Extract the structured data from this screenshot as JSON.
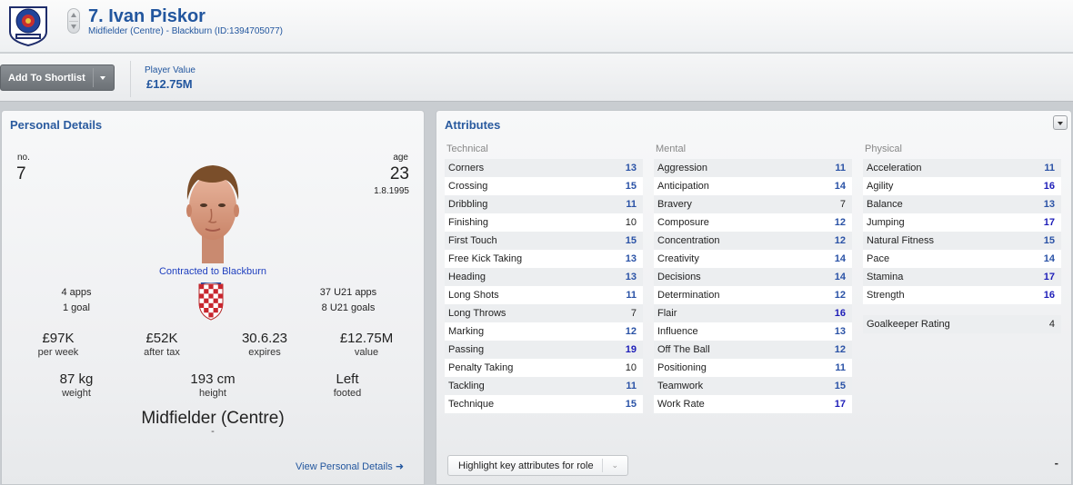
{
  "header": {
    "player_name": "7. Ivan Piskor",
    "subtitle": "Midfielder (Centre) - Blackburn (ID:1394705077)"
  },
  "toolbar": {
    "shortlist_label": "Add To Shortlist",
    "value_label": "Player Value",
    "value_amount": "£12.75M"
  },
  "personal": {
    "title": "Personal Details",
    "no_label": "no.",
    "no_value": "7",
    "age_label": "age",
    "age_value": "23",
    "dob": "1.8.1995",
    "contract": "Contracted to Blackburn",
    "apps": "4 apps",
    "goals": "1 goal",
    "u21_apps": "37 U21 apps",
    "u21_goals": "8 U21 goals",
    "stats": [
      {
        "value": "£97K",
        "label": "per week"
      },
      {
        "value": "£52K",
        "label": "after tax"
      },
      {
        "value": "30.6.23",
        "label": "expires"
      },
      {
        "value": "£12.75M",
        "label": "value"
      }
    ],
    "body": [
      {
        "value": "87 kg",
        "label": "weight"
      },
      {
        "value": "193 cm",
        "label": "height"
      },
      {
        "value": "Left",
        "label": "footed"
      }
    ],
    "position": "Midfielder (Centre)",
    "position_sub": "-",
    "view_link": "View Personal Details ➜"
  },
  "attributes": {
    "title": "Attributes",
    "technical_head": "Technical",
    "mental_head": "Mental",
    "physical_head": "Physical",
    "technical": [
      {
        "name": "Corners",
        "value": "13"
      },
      {
        "name": "Crossing",
        "value": "15"
      },
      {
        "name": "Dribbling",
        "value": "11"
      },
      {
        "name": "Finishing",
        "value": "10"
      },
      {
        "name": "First Touch",
        "value": "15"
      },
      {
        "name": "Free Kick Taking",
        "value": "13"
      },
      {
        "name": "Heading",
        "value": "13"
      },
      {
        "name": "Long Shots",
        "value": "11"
      },
      {
        "name": "Long Throws",
        "value": "7"
      },
      {
        "name": "Marking",
        "value": "12"
      },
      {
        "name": "Passing",
        "value": "19"
      },
      {
        "name": "Penalty Taking",
        "value": "10"
      },
      {
        "name": "Tackling",
        "value": "11"
      },
      {
        "name": "Technique",
        "value": "15"
      }
    ],
    "mental": [
      {
        "name": "Aggression",
        "value": "11"
      },
      {
        "name": "Anticipation",
        "value": "14"
      },
      {
        "name": "Bravery",
        "value": "7"
      },
      {
        "name": "Composure",
        "value": "12"
      },
      {
        "name": "Concentration",
        "value": "12"
      },
      {
        "name": "Creativity",
        "value": "14"
      },
      {
        "name": "Decisions",
        "value": "14"
      },
      {
        "name": "Determination",
        "value": "12"
      },
      {
        "name": "Flair",
        "value": "16"
      },
      {
        "name": "Influence",
        "value": "13"
      },
      {
        "name": "Off The Ball",
        "value": "12"
      },
      {
        "name": "Positioning",
        "value": "11"
      },
      {
        "name": "Teamwork",
        "value": "15"
      },
      {
        "name": "Work Rate",
        "value": "17"
      }
    ],
    "physical": [
      {
        "name": "Acceleration",
        "value": "11"
      },
      {
        "name": "Agility",
        "value": "16"
      },
      {
        "name": "Balance",
        "value": "13"
      },
      {
        "name": "Jumping",
        "value": "17"
      },
      {
        "name": "Natural Fitness",
        "value": "15"
      },
      {
        "name": "Pace",
        "value": "14"
      },
      {
        "name": "Stamina",
        "value": "17"
      },
      {
        "name": "Strength",
        "value": "16"
      }
    ],
    "goalkeeper": {
      "name": "Goalkeeper Rating",
      "value": "4"
    },
    "highlight_select": "Highlight key attributes for role",
    "minus_mark": "-"
  },
  "colors": {
    "accent": "#22569e",
    "attr_blue": "#2a52a6",
    "attr_top": "#1d1db8",
    "contract": "#1f3fbf"
  },
  "icons": {
    "crest": "club-crest-icon",
    "switch": "prev-next-player-icon",
    "flag": "croatia-flag-icon",
    "attr_menu": "chevron-down-icon"
  }
}
